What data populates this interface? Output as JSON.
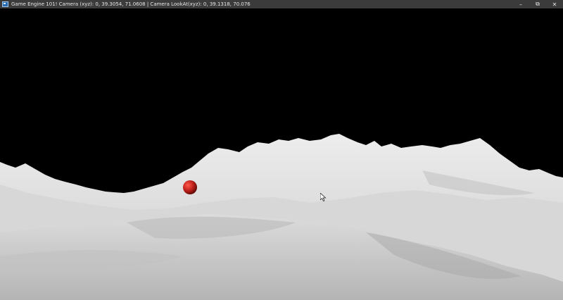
{
  "window": {
    "title": "Game Engine 101! Camera (xyz): 0, 39.3054, 71.0608 | Camera LookAt(xyz): 0, 39.1318, 70.076",
    "controls": {
      "minimize": "–",
      "maximize": "⧉",
      "close": "✕"
    }
  },
  "scene": {
    "background_color": "#000000",
    "terrain_color": "#e2e2e2",
    "sphere_color": "#c0211b",
    "objects": [
      "snow-terrain",
      "red-sphere",
      "mouse-cursor"
    ]
  }
}
